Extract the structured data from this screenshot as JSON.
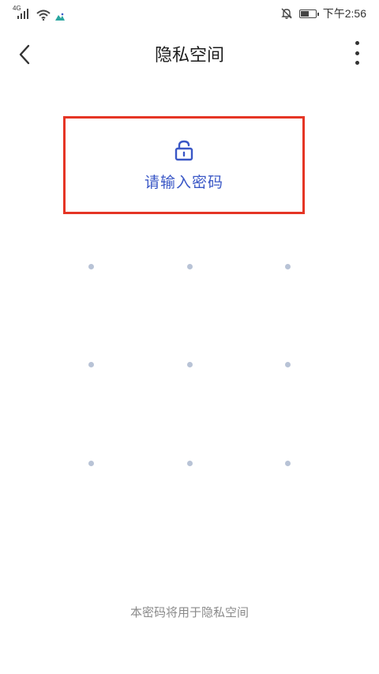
{
  "status_bar": {
    "network": "4G",
    "time": "下午2:56",
    "battery_level": 0.6
  },
  "header": {
    "title": "隐私空间",
    "back_icon": "chevron-left-icon",
    "more_icon": "more-vertical-icon"
  },
  "prompt": {
    "icon": "unlock-icon",
    "text": "请输入密码",
    "accent_color": "#3a57c6",
    "highlight_border_color": "#e53525"
  },
  "pattern_lock": {
    "rows": 3,
    "cols": 3,
    "dot_color": "#b8c3d6"
  },
  "footer": {
    "note": "本密码将用于隐私空间"
  }
}
